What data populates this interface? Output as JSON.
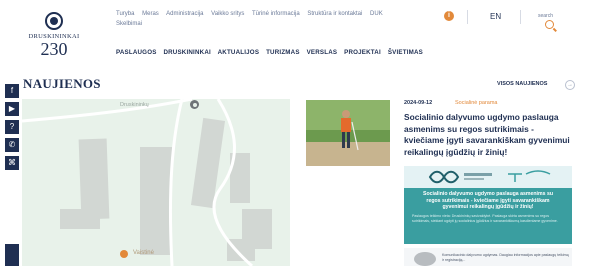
{
  "logo": {
    "city": "DRUSKININKAI",
    "number": "230"
  },
  "top_links": [
    "Turybа",
    "Meras",
    "Administracija",
    "Vaikko sritys",
    "Tūrinė informacija",
    "Struktūra ir kontaktai",
    "DUK",
    "Skelbimai"
  ],
  "lang": "EN",
  "search_label": "search",
  "main_nav": [
    "PASLAUGOS",
    "DRUSKININKAI",
    "AKTUALIJOS",
    "TURIZMAS",
    "VERSLAS",
    "PROJEKTAI",
    "ŠVIETIMAS"
  ],
  "section_title": "NAUJIENOS",
  "all_news_label": "VISOS NAUJIENOS",
  "map": {
    "poi_label": "Druskininkų",
    "poi2_label": "Vaistinė"
  },
  "article": {
    "date": "2024-09-12",
    "category": "Socialinė parama",
    "headline": "Socialinio dalyvumo ugdymo paslauga asmenims su regos sutrikimais - kviečiame įgyti savarankiškam gyvenimui reikalingų įgūdžių ir žinių!"
  },
  "banner": {
    "title": "Socialinio dalyvumo ugdymo paslauga asmenims su regos sutrikimais - kviečiame įgyti savarankiškam gyvenimui reikalingų įgūdžių ir žinių!",
    "body": "Paslaugos teikimo vieta: Druskininkų savivaldybė. Paslauga skirta asmenims su regos sutrikimais, siekiant ugdyti jų socialinius įgūdžius ir savarankiškumą kasdieniame gyvenime."
  },
  "card2": {
    "text": "Komunikacinio dalyvumo ugdymas. Daugiau informacijos apie paslaugų teikimą ir registraciją..."
  },
  "colors": {
    "navy": "#1f2f52",
    "orange": "#e2893a",
    "teal": "#3a9ea0"
  }
}
